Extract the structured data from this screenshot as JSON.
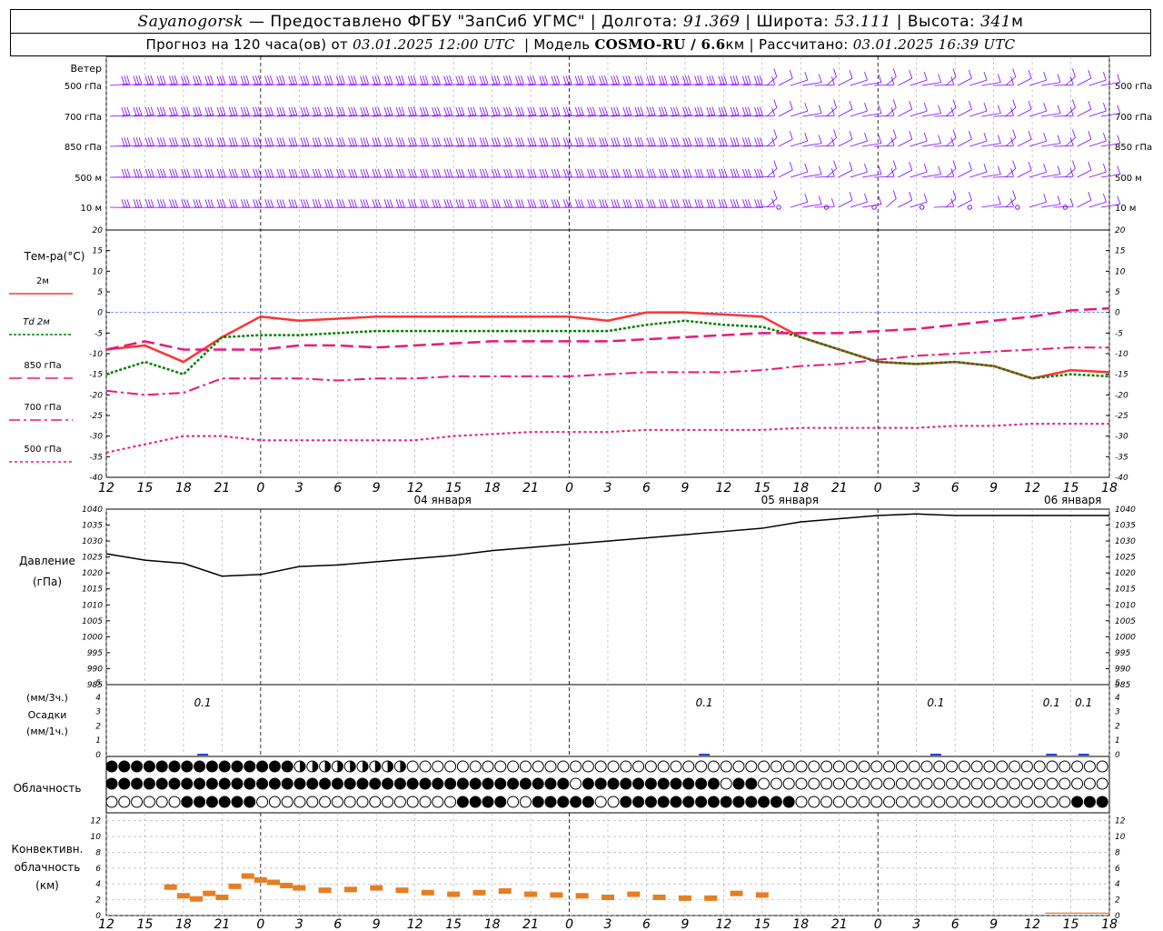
{
  "header": {
    "location": "Sayanogorsk",
    "provider": "— Предоставлено ФГБУ \"ЗапСиб УГМС\"",
    "lon_label": "Долгота:",
    "lon": "91.369",
    "lat_label": "Широта:",
    "lat": "53.111",
    "alt_label": "Высота:",
    "alt": "341",
    "alt_unit": "м",
    "forecast_label": "Прогноз на 120 часа(ов) от",
    "forecast_from": "03.01.2025 12:00 UTC",
    "model_label": "Модель",
    "model": "COSMO-RU / 6.6",
    "model_unit": "км",
    "calc_label": "Рассчитано:",
    "calc_time": "03.01.2025 16:39 UTC"
  },
  "time_axis": {
    "tick_labels": [
      "12",
      "15",
      "18",
      "21",
      "0",
      "3",
      "6",
      "9",
      "12",
      "15",
      "18",
      "21",
      "0",
      "3",
      "6",
      "9",
      "12",
      "15",
      "18",
      "21",
      "0",
      "3",
      "6",
      "9",
      "12",
      "15",
      "18"
    ],
    "day_labels": [
      "04 января",
      "05 января",
      "06 января"
    ]
  },
  "wind_panel": {
    "title": "Ветер",
    "levels": [
      "500 гПа",
      "700 гПа",
      "850 гПа",
      "500 м",
      "10 м"
    ],
    "barb_color": "#7f00ff"
  },
  "chart_data": [
    {
      "type": "line",
      "title": "Тем-ра(°C)",
      "ylim": [
        -40,
        20
      ],
      "yticks": [
        "20",
        "15",
        "10",
        "5",
        "0",
        "-5",
        "-10",
        "-15",
        "-20",
        "-25",
        "-30",
        "-35",
        "-40"
      ],
      "x_hours": [
        0,
        3,
        6,
        9,
        12,
        15,
        18,
        21,
        24,
        27,
        30,
        33,
        36,
        39,
        42,
        45,
        48,
        51,
        54,
        57,
        60,
        63,
        66,
        69,
        72,
        75,
        78
      ],
      "series": [
        {
          "name": "2м",
          "color": "#ff3333",
          "values": [
            -9,
            -8,
            -12,
            -6,
            -1,
            -2,
            -1.5,
            -1,
            -1,
            -1,
            -1,
            -1,
            -1,
            -2,
            0,
            0,
            -0.5,
            -1,
            -6,
            -9,
            -12,
            -12.5,
            -12,
            -13,
            -16,
            -14,
            -14.5
          ]
        },
        {
          "name": "Td 2м",
          "color": "#008000",
          "values": [
            -15,
            -12,
            -15,
            -6,
            -5.5,
            -5.5,
            -5,
            -4.5,
            -4.5,
            -4.5,
            -4.5,
            -4.5,
            -4.5,
            -4.5,
            -3,
            -2,
            -3,
            -3.5,
            -6,
            -9,
            -12,
            -12.5,
            -12,
            -13,
            -16,
            -15,
            -15.5
          ]
        },
        {
          "name": "850 гПа",
          "color": "#e8187c",
          "values": [
            -9,
            -7,
            -9,
            -9,
            -9,
            -8,
            -8,
            -8.5,
            -8,
            -7.5,
            -7,
            -7,
            -7,
            -7,
            -6.5,
            -6,
            -5.5,
            -5,
            -5,
            -5,
            -4.5,
            -4,
            -3,
            -2,
            -1,
            0.5,
            1
          ]
        },
        {
          "name": "700 гПа",
          "color": "#e8187c",
          "values": [
            -19,
            -20,
            -19.5,
            -16,
            -16,
            -16,
            -16.5,
            -16,
            -16,
            -15.5,
            -15.5,
            -15.5,
            -15.5,
            -15,
            -14.5,
            -14.5,
            -14.5,
            -14,
            -13,
            -12.5,
            -11.5,
            -10.5,
            -10,
            -9.5,
            -9,
            -8.5,
            -8.5
          ]
        },
        {
          "name": "500 гПа",
          "color": "#e8187c",
          "values": [
            -34,
            -32,
            -30,
            -30,
            -31,
            -31,
            -31,
            -31,
            -31,
            -30,
            -29.5,
            -29,
            -29,
            -29,
            -28.5,
            -28.5,
            -28.5,
            -28.5,
            -28,
            -28,
            -28,
            -28,
            -27.5,
            -27.5,
            -27,
            -27,
            -27
          ]
        }
      ],
      "legend": [
        "2м",
        "Td 2м",
        "850 гПа",
        "700 гПа",
        "500 гПа"
      ]
    },
    {
      "type": "line",
      "title": "Давление",
      "unit": "(гПа)",
      "ylim": [
        985,
        1040
      ],
      "yticks": [
        "1040",
        "1035",
        "1030",
        "1025",
        "1020",
        "1015",
        "1010",
        "1005",
        "1000",
        "995",
        "990",
        "985"
      ],
      "x_hours": [
        0,
        3,
        6,
        9,
        12,
        15,
        18,
        21,
        24,
        27,
        30,
        33,
        36,
        39,
        42,
        45,
        48,
        51,
        54,
        57,
        60,
        63,
        66,
        69,
        72,
        75,
        78
      ],
      "series": [
        {
          "name": "P",
          "color": "#000000",
          "values": [
            1026,
            1024,
            1023,
            1019,
            1019.5,
            1022,
            1022.5,
            1023.5,
            1024.5,
            1025.5,
            1027,
            1028,
            1029,
            1030,
            1031,
            1032,
            1033,
            1034,
            1036,
            1037,
            1038,
            1038.5,
            1038,
            1038,
            1038,
            1038,
            1038
          ]
        }
      ]
    },
    {
      "type": "bar",
      "title": "Осадки",
      "unit_3h": "(мм/3ч.)",
      "unit_1h": "(мм/1ч.)",
      "ylim": [
        0,
        5
      ],
      "yticks": [
        "5",
        "4",
        "3",
        "2",
        "1",
        "0"
      ],
      "annotations": [
        "0.1",
        "0.1",
        "0.1",
        "0.1",
        "0.1"
      ],
      "annotation_hours": [
        7.5,
        46.5,
        64.5,
        73.5,
        76
      ]
    },
    {
      "type": "bar",
      "title": "Конвективн. облачность",
      "unit": "(км)",
      "ylim": [
        0,
        13
      ],
      "yticks": [
        "12",
        "10",
        "8",
        "6",
        "4",
        "2",
        "0"
      ],
      "color": "#e67e22",
      "x_hours": [
        5,
        6,
        7,
        8,
        9,
        10,
        11,
        12,
        13,
        14,
        15,
        17,
        19,
        21,
        23,
        25,
        27,
        29,
        31,
        33,
        35,
        37,
        39,
        41,
        43,
        45,
        47,
        49,
        51
      ],
      "values": [
        3.6,
        2.5,
        2.1,
        2.8,
        2.3,
        3.7,
        5.0,
        4.5,
        4.2,
        3.8,
        3.5,
        3.2,
        3.3,
        3.5,
        3.2,
        2.9,
        2.7,
        2.9,
        3.1,
        2.7,
        2.6,
        2.5,
        2.3,
        2.7,
        2.3,
        2.2,
        2.2,
        2.8,
        2.6
      ]
    }
  ],
  "cloud_panel": {
    "title": "Облачность"
  }
}
